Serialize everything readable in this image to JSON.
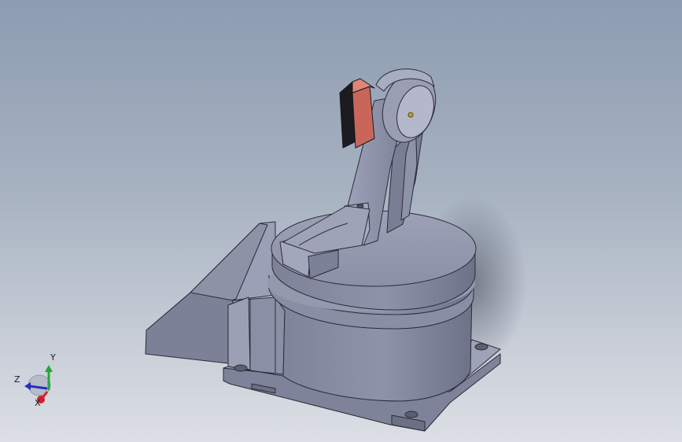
{
  "viewport": {
    "background_top": "#8d9cb1",
    "background_bottom": "#dcdfe5",
    "model_color": "#8a8ea4",
    "accent_part_color": "#c9665a"
  },
  "triad": {
    "x_label": "X",
    "y_label": "Y",
    "z_label": "Z",
    "x_color": "#d0202a",
    "y_color": "#22a83a",
    "z_color": "#2030c0"
  }
}
